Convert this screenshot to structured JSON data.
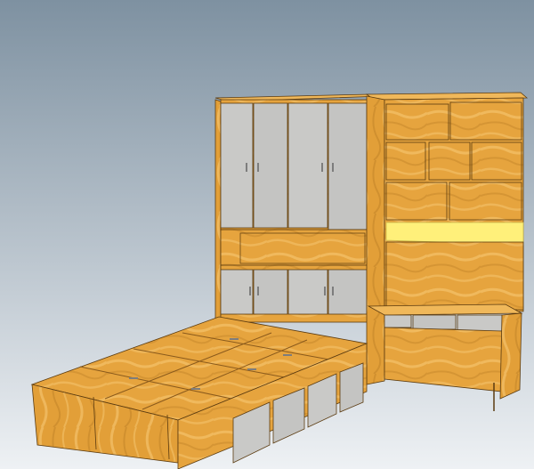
{
  "viewport": {
    "background_top": "#7e91a1",
    "background_bottom": "#eef1f4"
  },
  "model": {
    "colors": {
      "wood": "#e6a43e",
      "wood_light": "#f0b85a",
      "wood_dark": "#c98a2d",
      "wood_edge": "#b07724",
      "door_grey": "#c9c9c7",
      "door_grey_dark": "#b3b3b1",
      "handle": "#7d7d7d",
      "led_strip": "#fff07a",
      "outline": "#5b3b10"
    },
    "icons": [
      "wood-grain-icon",
      "door-handle-icon"
    ]
  }
}
